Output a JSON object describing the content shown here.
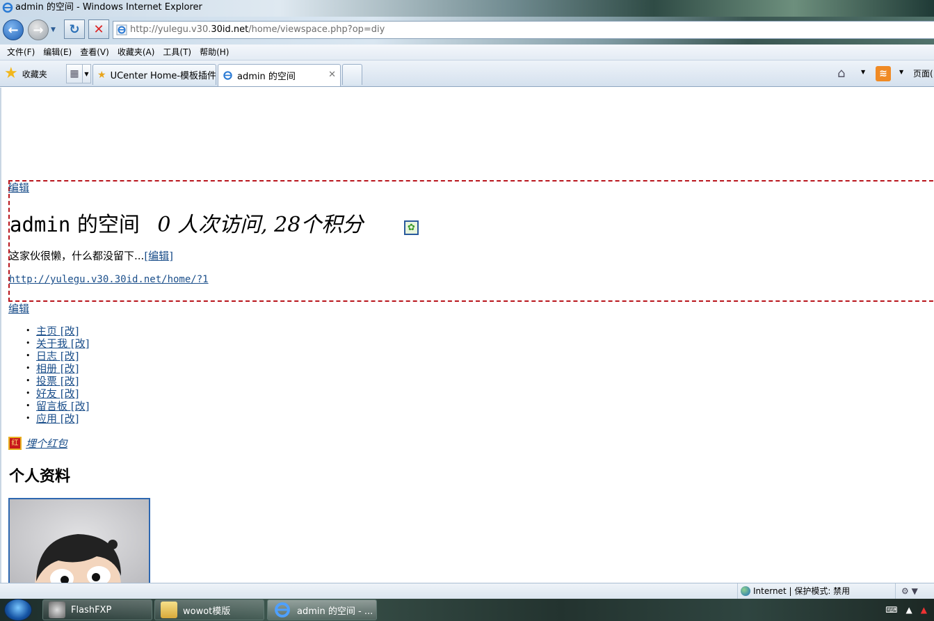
{
  "window": {
    "title": "admin 的空间 - Windows Internet Explorer"
  },
  "address": {
    "url_prefix": "http://yulegu.v30.",
    "url_domain": "30id.net",
    "url_suffix": "/home/viewspace.php?op=diy"
  },
  "menu": {
    "file": "文件(F)",
    "edit": "编辑(E)",
    "view": "查看(V)",
    "favorites": "收藏夹(A)",
    "tools": "工具(T)",
    "help": "帮助(H)"
  },
  "tabbar": {
    "favorites_label": "收藏夹",
    "tabs": [
      {
        "label": "UCenter Home-模板插件..."
      },
      {
        "label": "admin 的空间"
      }
    ],
    "page_menu": "页面("
  },
  "content": {
    "edit_label": "编辑",
    "space_name": "admin",
    "space_suffix": "的空间",
    "visit_text": "0 人次访问, 28个积分",
    "bio": "这家伙很懒，什么都没留下...",
    "bio_edit": "[编辑]",
    "space_url": "http://yulegu.v30.30id.net/home/?1",
    "nav_items": [
      {
        "label": "主页 [改]"
      },
      {
        "label": "关于我 [改]"
      },
      {
        "label": "日志 [改]"
      },
      {
        "label": "相册 [改]"
      },
      {
        "label": "投票 [改]"
      },
      {
        "label": "好友 [改]"
      },
      {
        "label": "留言板 [改]"
      },
      {
        "label": "应用 [改]"
      }
    ],
    "redpack_icon_text": "红",
    "redpack_label": "埋个红包",
    "profile_heading": "个人资料"
  },
  "statusbar": {
    "zone": "Internet | 保护模式: 禁用"
  },
  "taskbar": {
    "tasks": [
      {
        "label": "FlashFXP"
      },
      {
        "label": "wowot模版"
      },
      {
        "label": "admin 的空间 - ..."
      }
    ]
  },
  "colors": {
    "link": "#1a4e8a",
    "dashed_border": "#b8141b",
    "avatar_border": "#2d67b0"
  }
}
